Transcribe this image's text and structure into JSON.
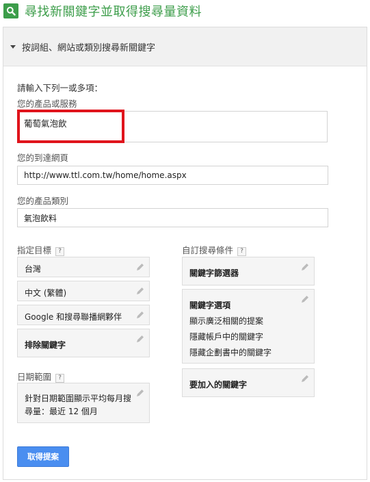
{
  "header": {
    "title": "尋找新關鍵字並取得搜尋量資料",
    "icon": "search-icon"
  },
  "section": {
    "label": "按詞組、網站或類別搜尋新關鍵字"
  },
  "form": {
    "intro": "請輸入下列一或多項：",
    "product_label": "您的產品或服務",
    "product_value": "葡萄氣泡飲",
    "landing_label": "您的到達網頁",
    "landing_value": "http://www.ttl.com.tw/home/home.aspx",
    "category_label": "您的產品類別",
    "category_value": "氣泡飲料"
  },
  "targeting": {
    "title": "指定目標",
    "help": "?",
    "location": "台灣",
    "language": "中文 (繁體)",
    "network": "Google 和搜尋聯播網夥伴",
    "negative": "排除關鍵字"
  },
  "date_range": {
    "title": "日期範圍",
    "help": "?",
    "line1": "針對日期範圍顯示平均每月搜",
    "line2": "尋量：最近 12 個月"
  },
  "custom": {
    "title": "自訂搜尋條件",
    "help": "?",
    "filter": "關鍵字篩選器",
    "options_title": "關鍵字選項",
    "options": [
      "顯示廣泛相關的提案",
      "隱藏帳戶中的關鍵字",
      "隱藏企劃書中的關鍵字"
    ],
    "include": "要加入的關鍵字"
  },
  "actions": {
    "get_ideas": "取得提案"
  },
  "colors": {
    "brand_green": "#3c9d4a",
    "button_blue": "#4a8ef0",
    "highlight_red": "#e0141c"
  }
}
